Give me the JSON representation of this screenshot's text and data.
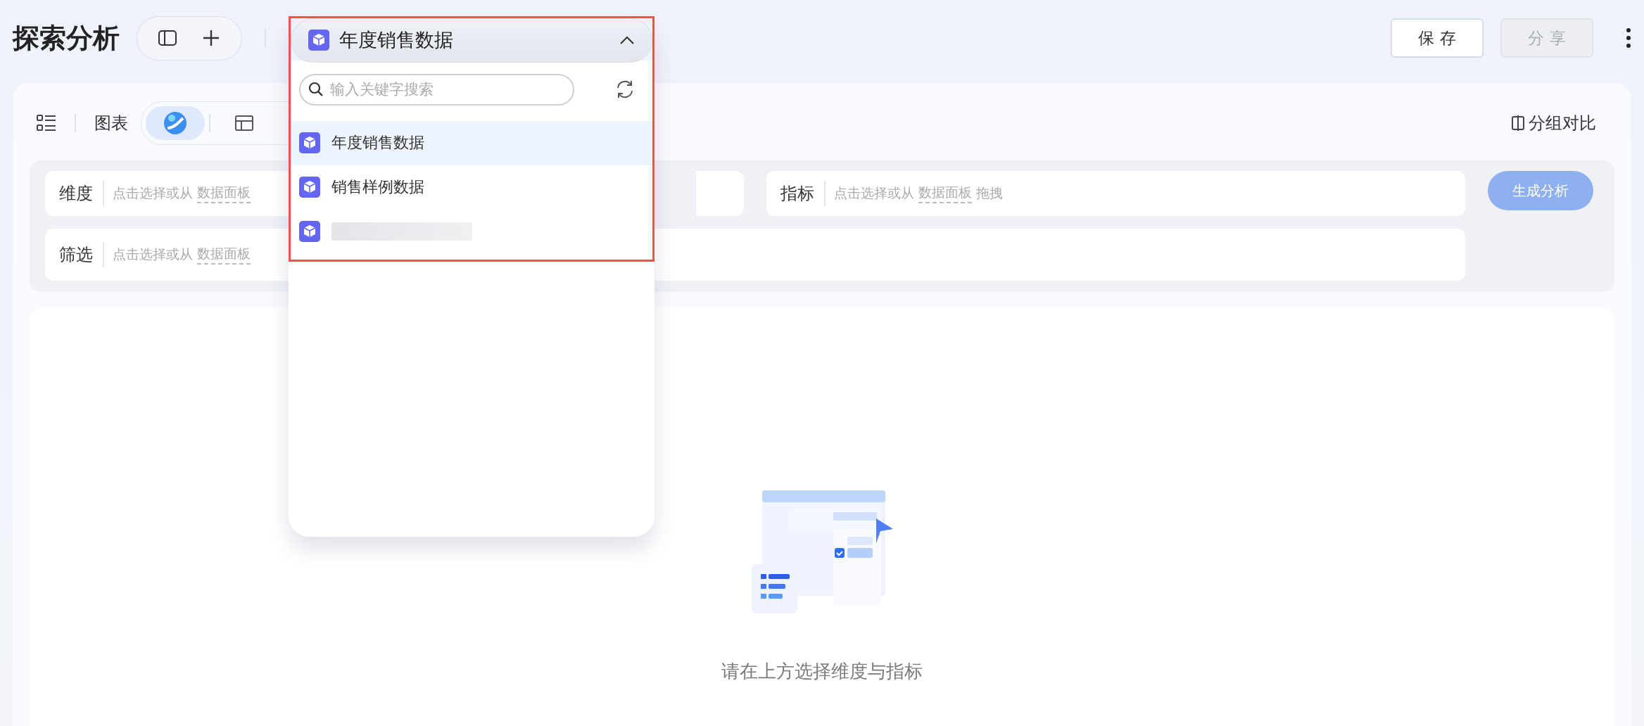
{
  "header": {
    "title": "探索分析"
  },
  "dataset_picker": {
    "value": "年度销售数据",
    "expanded": true
  },
  "dropdown": {
    "search": {
      "placeholder": "输入关键字搜索"
    },
    "items": [
      {
        "kind": "text",
        "label": "年度销售数据",
        "selected": true
      },
      {
        "kind": "text",
        "label": "销售样例数据",
        "selected": false
      },
      {
        "kind": "masked",
        "selected": false
      }
    ]
  },
  "actions": [
    {
      "label": "保 存",
      "disabled": false
    },
    {
      "label": "分 享",
      "disabled": true
    }
  ],
  "view_bar": {
    "label": "图表",
    "modes": [
      {
        "kind": "ai",
        "selected": true
      },
      {
        "kind": "table",
        "selected": false
      }
    ],
    "compare": "分组对比"
  },
  "query": {
    "fields": [
      {
        "label": "维度",
        "hint": "点击选择或从",
        "link": "数据面板"
      },
      {
        "label": "指标",
        "hint": "点击选择或从",
        "link": "数据面板",
        "suffix": "拖拽"
      },
      {
        "label": "筛选",
        "hint": "点击选择或从",
        "link": "数据面板"
      }
    ],
    "generate": {
      "label": "生成分析",
      "disabled": true
    }
  },
  "empty_state": {
    "message": "请在上方选择维度与指标"
  },
  "annotation": {
    "kind": "frame"
  }
}
